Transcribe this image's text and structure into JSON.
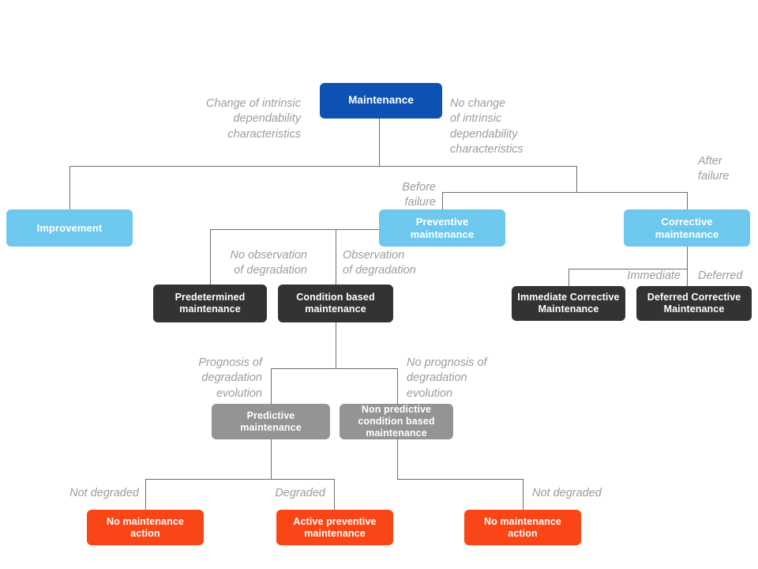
{
  "diagram": {
    "title": "Maintenance taxonomy tree",
    "colors": {
      "root": "#0d52b3",
      "level2": "#6ec8ee",
      "level3": "#333333",
      "level4": "#949494",
      "leaf": "#fa4616",
      "connector": "#6e6e6e",
      "edge_label": "#9c9c9c"
    },
    "nodes": {
      "maintenance": "Maintenance",
      "improvement": "Improvement",
      "preventive_maintenance": "Preventive\nmaintenance",
      "corrective_maintenance": "Corrective\nmaintenance",
      "predetermined_maintenance": "Predetermined\nmaintenance",
      "condition_based_maintenance": "Condition based\nmaintenance",
      "immediate_corrective_maintenance": "Immediate\nCorrective\nMaintenance",
      "deferred_corrective_maintenance": "Deferred\nCorrective\nMaintenance",
      "predictive_maintenance": "Predictive\nmaintenance",
      "non_predictive_condition_based_maintenance": "Non predictive\ncondition based\nmaintenance",
      "no_maintenance_action_left": "No maintenance\naction",
      "active_preventive_maintenance": "Active preventive\nmaintenance",
      "no_maintenance_action_right": "No maintenance\naction"
    },
    "edge_labels": {
      "change_of_intrinsic": "Change of intrinsic\ndependability\ncharacteristics",
      "no_change_of_intrinsic": "No change\nof intrinsic\ndependability\ncharacteristics",
      "before_failure": "Before\nfailure",
      "after_failure": "After\nfailure",
      "no_observation_of_degradation": "No observation\nof degradation",
      "observation_of_degradation": "Observation\nof degradation",
      "immediate": "Immediate",
      "deferred": "Deferred",
      "prognosis_of_degradation_evolution": "Prognosis of\ndegradation\nevolution",
      "no_prognosis_of_degradation_evolution": "No prognosis of\ndegradation\nevolution",
      "not_degraded_left": "Not degraded",
      "degraded": "Degraded",
      "not_degraded_right": "Not degraded"
    }
  }
}
